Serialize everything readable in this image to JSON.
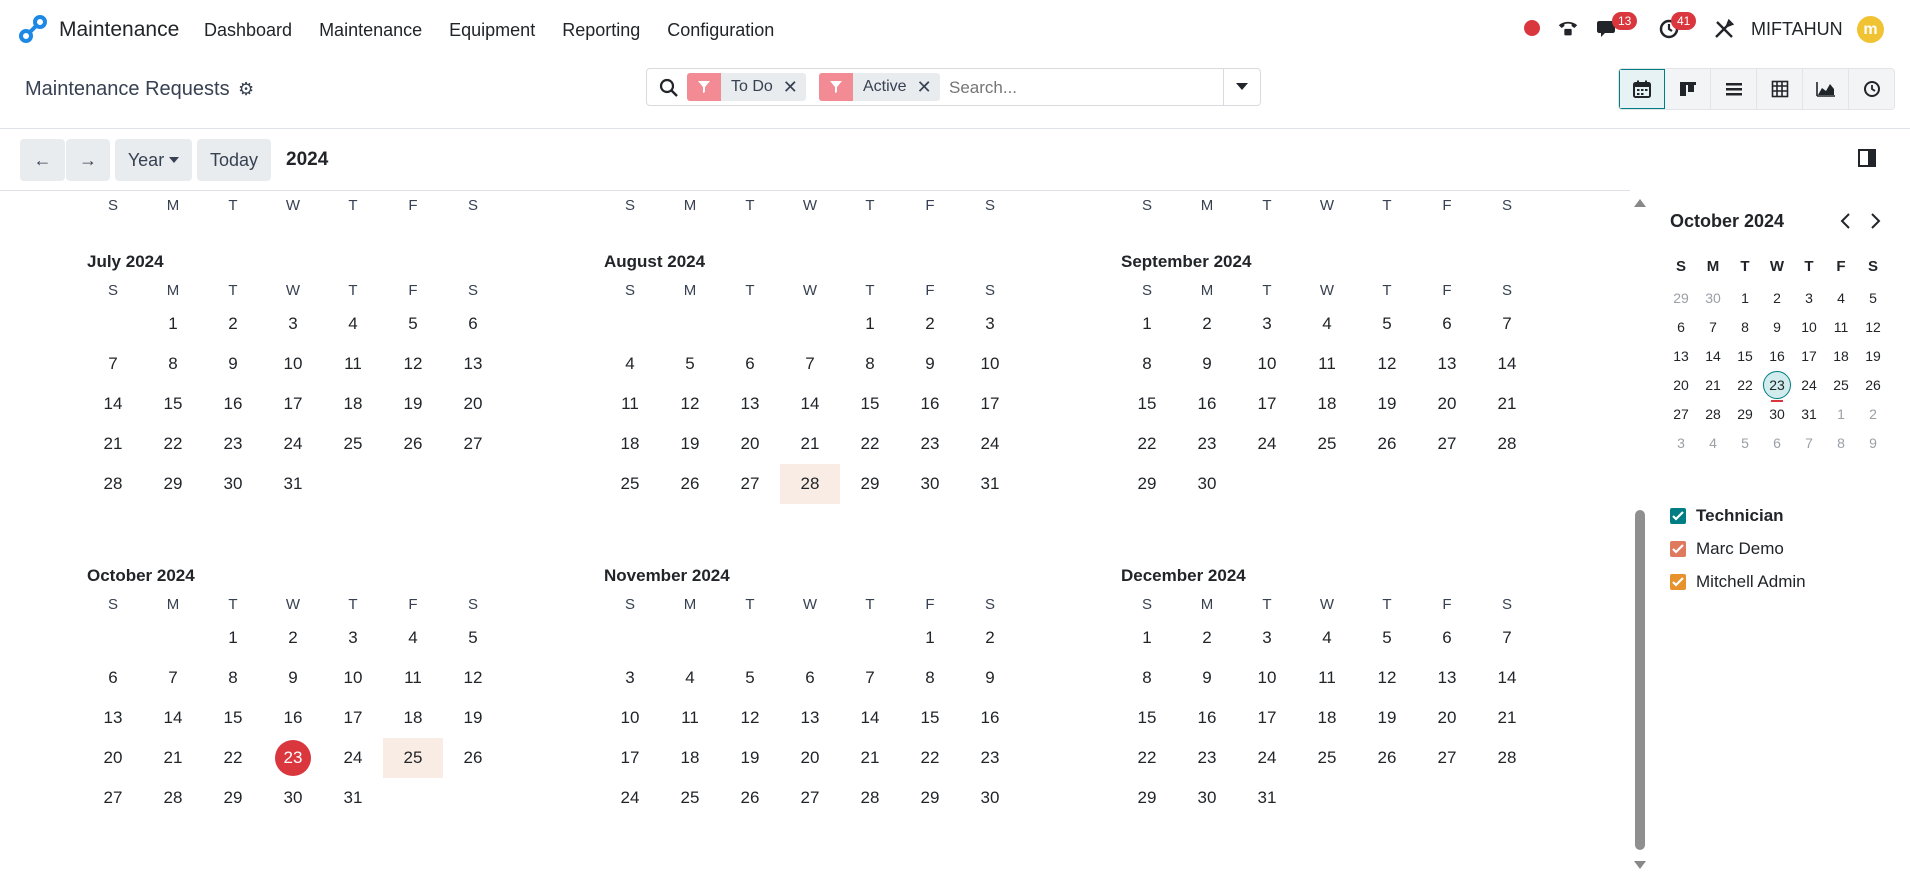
{
  "navbar": {
    "app_name": "Maintenance",
    "menu": [
      "Dashboard",
      "Maintenance",
      "Equipment",
      "Reporting",
      "Configuration"
    ],
    "messages_count": "13",
    "activities_count": "41",
    "user_name": "MIFTAHUN",
    "avatar_initial": "m",
    "colors": {
      "brand": "#1e88e5",
      "badge": "#d9363e"
    }
  },
  "control_panel": {
    "title": "Maintenance Requests",
    "facets": [
      "To Do",
      "Active"
    ],
    "search_placeholder": "Search...",
    "views": [
      "calendar",
      "kanban",
      "list",
      "pivot",
      "graph",
      "activity"
    ],
    "active_view": "calendar"
  },
  "calendar": {
    "prev_label": "←",
    "next_label": "→",
    "scale_label": "Year",
    "today_label": "Today",
    "range_label": "2024",
    "weekday_labels": [
      "S",
      "M",
      "T",
      "W",
      "T",
      "F",
      "S"
    ],
    "months": [
      {
        "title": "July 2024",
        "offset": 1,
        "days": 31,
        "highlight": []
      },
      {
        "title": "August 2024",
        "offset": 4,
        "days": 31,
        "highlight": [
          28
        ]
      },
      {
        "title": "September 2024",
        "offset": 0,
        "days": 30,
        "highlight": []
      },
      {
        "title": "October 2024",
        "offset": 2,
        "days": 31,
        "highlight": [
          25
        ],
        "today": 23
      },
      {
        "title": "November 2024",
        "offset": 5,
        "days": 30,
        "highlight": []
      },
      {
        "title": "December 2024",
        "offset": 0,
        "days": 31,
        "highlight": []
      }
    ]
  },
  "sidebar": {
    "mini_title": "October 2024",
    "weekday_labels": [
      "S",
      "M",
      "T",
      "W",
      "T",
      "F",
      "S"
    ],
    "mini_days": [
      [
        "29",
        "30",
        "1",
        "2",
        "3",
        "4",
        "5"
      ],
      [
        "6",
        "7",
        "8",
        "9",
        "10",
        "11",
        "12"
      ],
      [
        "13",
        "14",
        "15",
        "16",
        "17",
        "18",
        "19"
      ],
      [
        "20",
        "21",
        "22",
        "23",
        "24",
        "25",
        "26"
      ],
      [
        "27",
        "28",
        "29",
        "30",
        "31",
        "1",
        "2"
      ],
      [
        "3",
        "4",
        "5",
        "6",
        "7",
        "8",
        "9"
      ]
    ],
    "selected_day": "23",
    "filter_title": "Technician",
    "filters": [
      {
        "label": "Marc Demo",
        "color": "#e07a5f"
      },
      {
        "label": "Mitchell Admin",
        "color": "#e8922e"
      }
    ],
    "filter_title_color": "#017e84"
  }
}
